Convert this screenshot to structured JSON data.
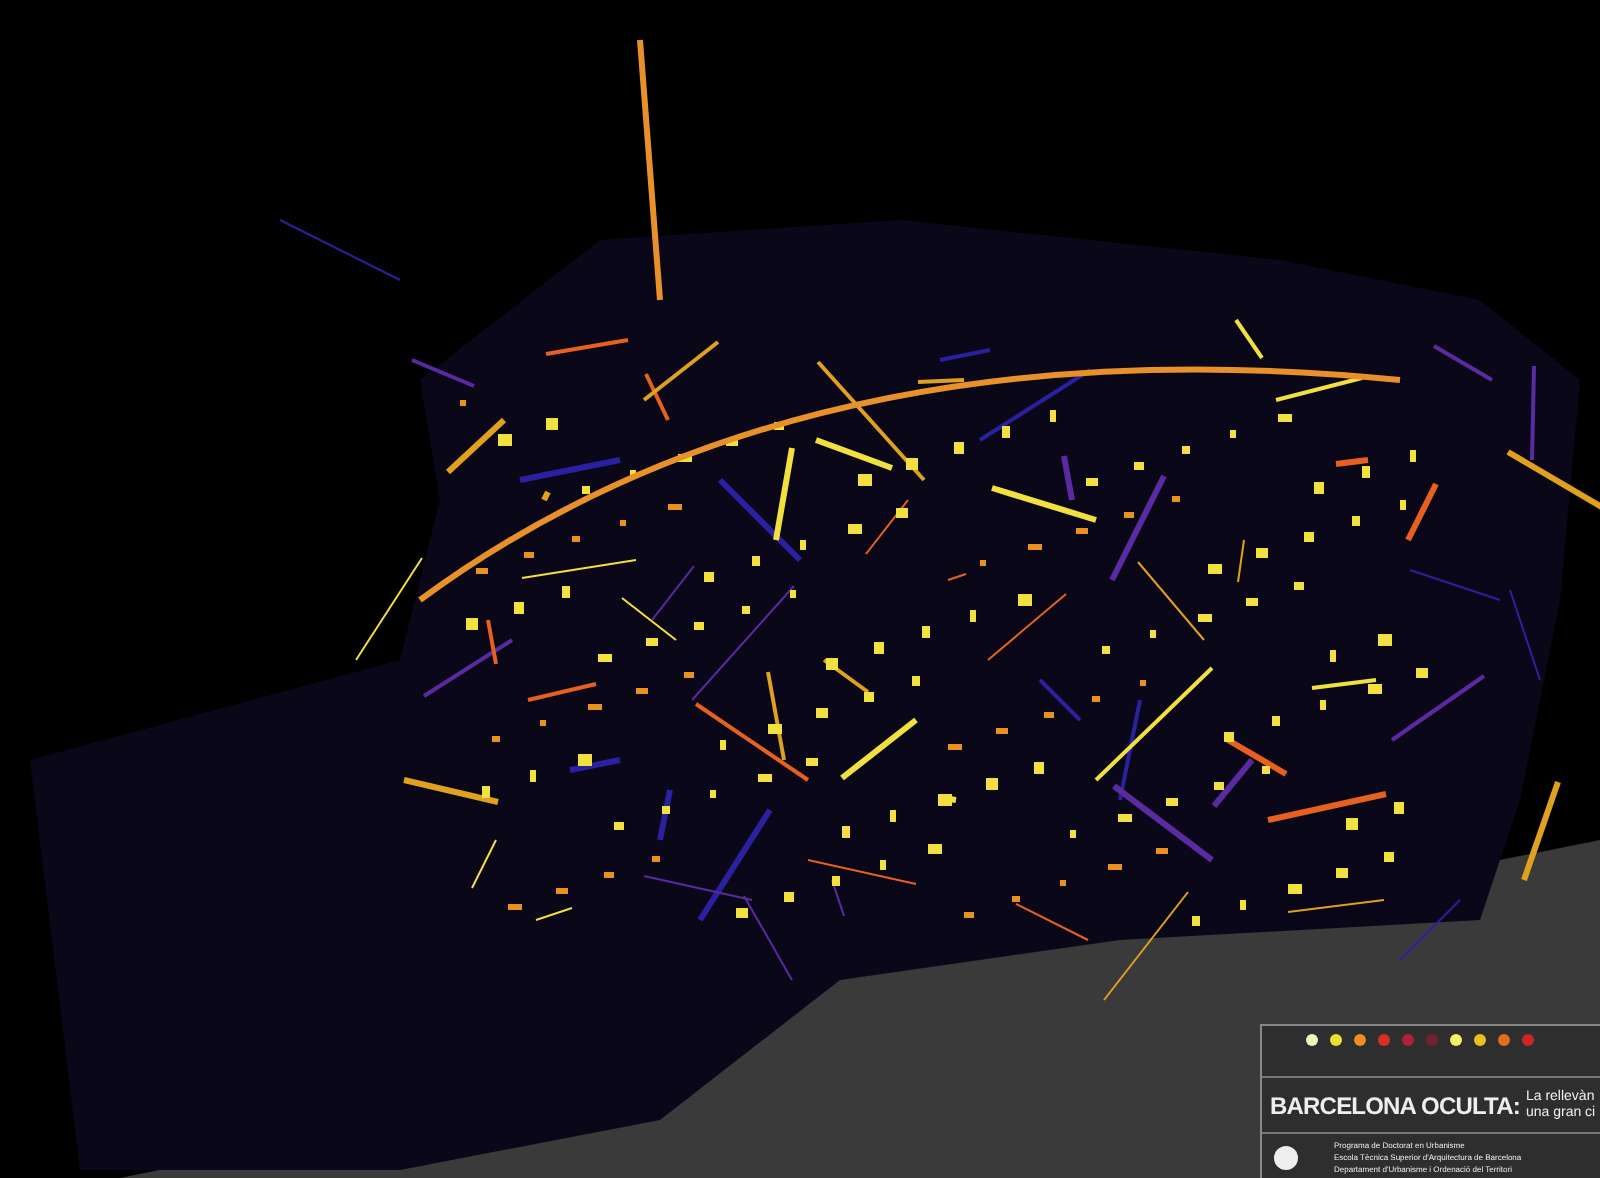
{
  "legend_panel": {
    "swatches": [
      {
        "color": "#f0f0c0"
      },
      {
        "color": "#e8e030"
      },
      {
        "color": "#e89020"
      },
      {
        "color": "#d83020"
      },
      {
        "color": "#b02030"
      },
      {
        "color": "#702030"
      },
      {
        "color": "#f0f060"
      },
      {
        "color": "#e8c020"
      },
      {
        "color": "#e07020"
      },
      {
        "color": "#c82828"
      }
    ],
    "title": "BARCELONA OCULTA:",
    "subtitle_lines": [
      "La rellevàn",
      "una gran ci"
    ],
    "institution_lines": [
      "Programa de Doctorat en Urbanisme",
      "Escola Tècnica Superior d'Arquitectura de Barcelona",
      "Departament d'Urbanisme i Ordenació del Territori"
    ]
  }
}
